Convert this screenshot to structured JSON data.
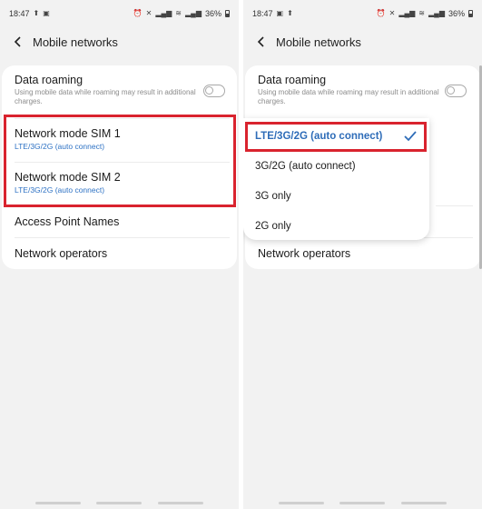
{
  "status": {
    "time": "18:47",
    "battery": "36%"
  },
  "app_bar": {
    "title": "Mobile networks"
  },
  "settings": {
    "data_roaming": {
      "title": "Data roaming",
      "subtitle": "Using mobile data while roaming may result in additional charges.",
      "enabled": false
    },
    "sim1": {
      "title": "Network mode SIM 1",
      "value": "LTE/3G/2G (auto connect)"
    },
    "sim2": {
      "title": "Network mode SIM 2",
      "value": "LTE/3G/2G (auto connect)"
    },
    "apn": {
      "title": "Access Point Names"
    },
    "operators": {
      "title": "Network operators"
    }
  },
  "network_mode_menu": {
    "options": [
      "LTE/3G/2G (auto connect)",
      "3G/2G (auto connect)",
      "3G only",
      "2G only"
    ],
    "selected": "LTE/3G/2G (auto connect)"
  },
  "colors": {
    "accent_blue": "#2e72c4",
    "highlight_red": "#d9232e",
    "background": "#f2f2f2",
    "card": "#ffffff"
  },
  "icons": {
    "back": "chevron-left-icon",
    "check": "check-icon",
    "alarm": "alarm-icon",
    "mute": "mute-icon",
    "signal": "signal-icon",
    "wifi": "wifi-icon",
    "battery": "battery-icon",
    "upload": "upload-icon",
    "gallery": "image-icon"
  }
}
